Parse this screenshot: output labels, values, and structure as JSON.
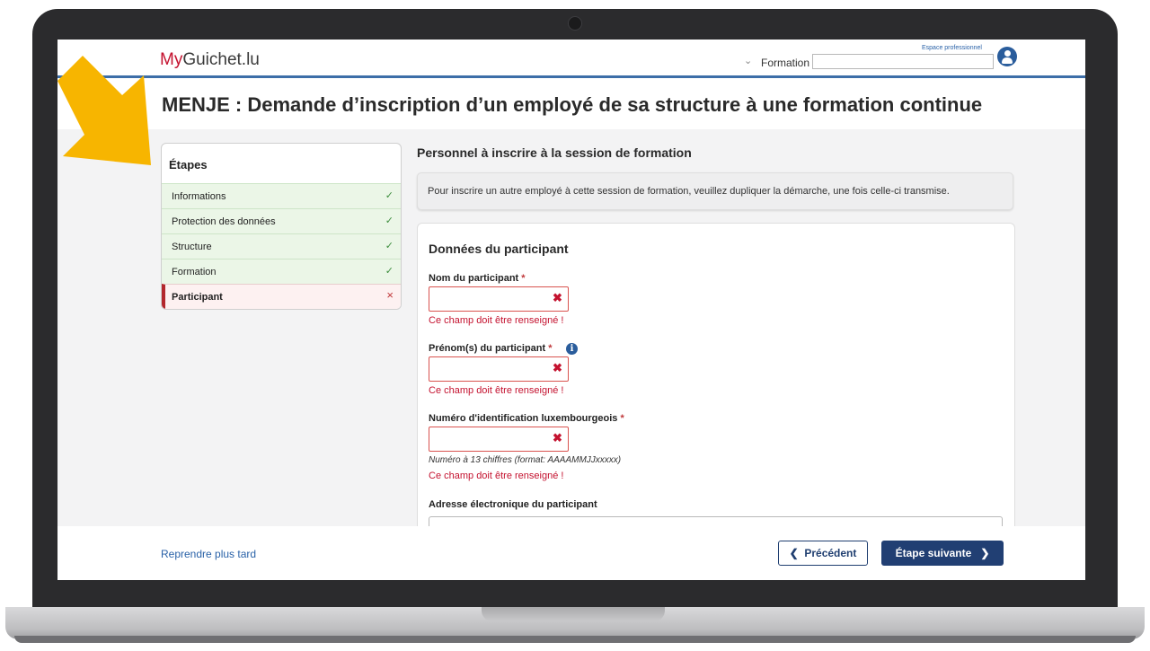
{
  "header": {
    "logo_my": "My",
    "logo_rest": "Guichet.lu",
    "formation_label": "Formation",
    "formation_value": "",
    "espace_link": "Espace professionnel",
    "avatar_icon": "user-icon"
  },
  "page": {
    "title": "MENJE : Demande d’inscription d’un employé de sa structure à une formation continue"
  },
  "steps": {
    "title": "Étapes",
    "items": [
      {
        "label": "Informations",
        "status": "done"
      },
      {
        "label": "Protection des données",
        "status": "done"
      },
      {
        "label": "Structure",
        "status": "done"
      },
      {
        "label": "Formation",
        "status": "done"
      },
      {
        "label": "Participant",
        "status": "error"
      }
    ]
  },
  "main": {
    "section_heading": "Personnel à inscrire à la session de formation",
    "notice": "Pour inscrire un autre employé à cette session de formation, veuillez dupliquer la démarche, une fois celle-ci transmise.",
    "card_title": "Données du participant",
    "fields": {
      "nom": {
        "label": "Nom du participant",
        "required": "*",
        "value": "",
        "error": "Ce champ doit être renseigné !"
      },
      "prenom": {
        "label": "Prénom(s) du participant",
        "required": "*",
        "value": "",
        "error": "Ce champ doit être renseigné !"
      },
      "matricule": {
        "label": "Numéro d'identification luxembourgeois",
        "required": "*",
        "value": "",
        "hint": "Numéro à 13 chiffres (format: AAAAMMJJxxxxx)",
        "error": "Ce champ doit être renseigné !"
      },
      "email": {
        "label": "Adresse électronique du participant",
        "value": ""
      }
    }
  },
  "footer": {
    "later_link": "Reprendre plus tard",
    "prev_label": "Précédent",
    "next_label": "Étape suivante"
  },
  "colors": {
    "brand_red": "#c4122f",
    "primary_blue": "#213f73",
    "step_done_bg": "#ebf6e7",
    "step_error_accent": "#b3272d",
    "arrow_yellow": "#f7b500"
  }
}
